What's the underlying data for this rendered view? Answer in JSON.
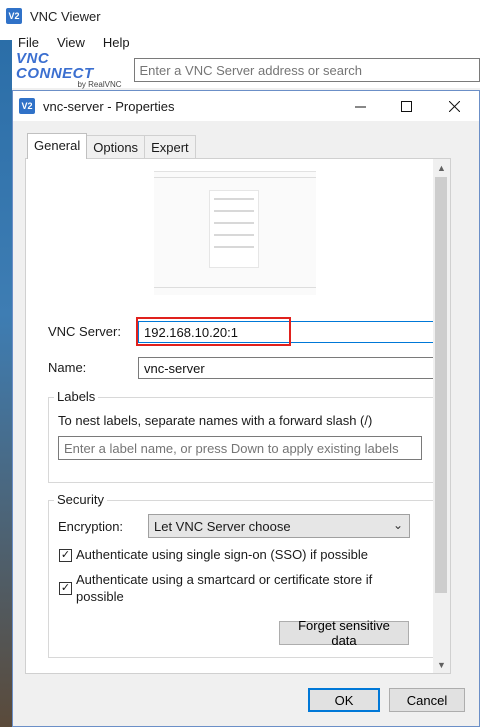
{
  "main_window": {
    "title": "VNC Viewer",
    "logo_text": "V2",
    "menu": [
      "File",
      "View",
      "Help"
    ],
    "brand": {
      "main": "VNC CONNECT",
      "sub": "by RealVNC"
    },
    "address_placeholder": "Enter a VNC Server address or search"
  },
  "dialog": {
    "title": "vnc-server - Properties",
    "tabs": [
      "General",
      "Options",
      "Expert"
    ],
    "active_tab": "General",
    "vnc_server": {
      "label": "VNC Server:",
      "value": "192.168.10.20:1"
    },
    "name": {
      "label": "Name:",
      "value": "vnc-server"
    },
    "labels_group": {
      "title": "Labels",
      "note": "To nest labels, separate names with a forward slash (/)",
      "placeholder": "Enter a label name, or press Down to apply existing labels"
    },
    "security_group": {
      "title": "Security",
      "encryption_label": "Encryption:",
      "encryption_value": "Let VNC Server choose",
      "sso_label": "Authenticate using single sign-on (SSO) if possible",
      "sso_checked": true,
      "smartcard_label_line1": "Authenticate using a smartcard or certificate store if",
      "smartcard_label_line2": "possible",
      "smartcard_checked": true,
      "forget_button": "Forget sensitive data"
    },
    "ok_button": "OK",
    "cancel_button": "Cancel"
  },
  "colors": {
    "highlight": "#e0211d",
    "focus_border": "#0078d7",
    "brand": "#3b6fd0"
  }
}
